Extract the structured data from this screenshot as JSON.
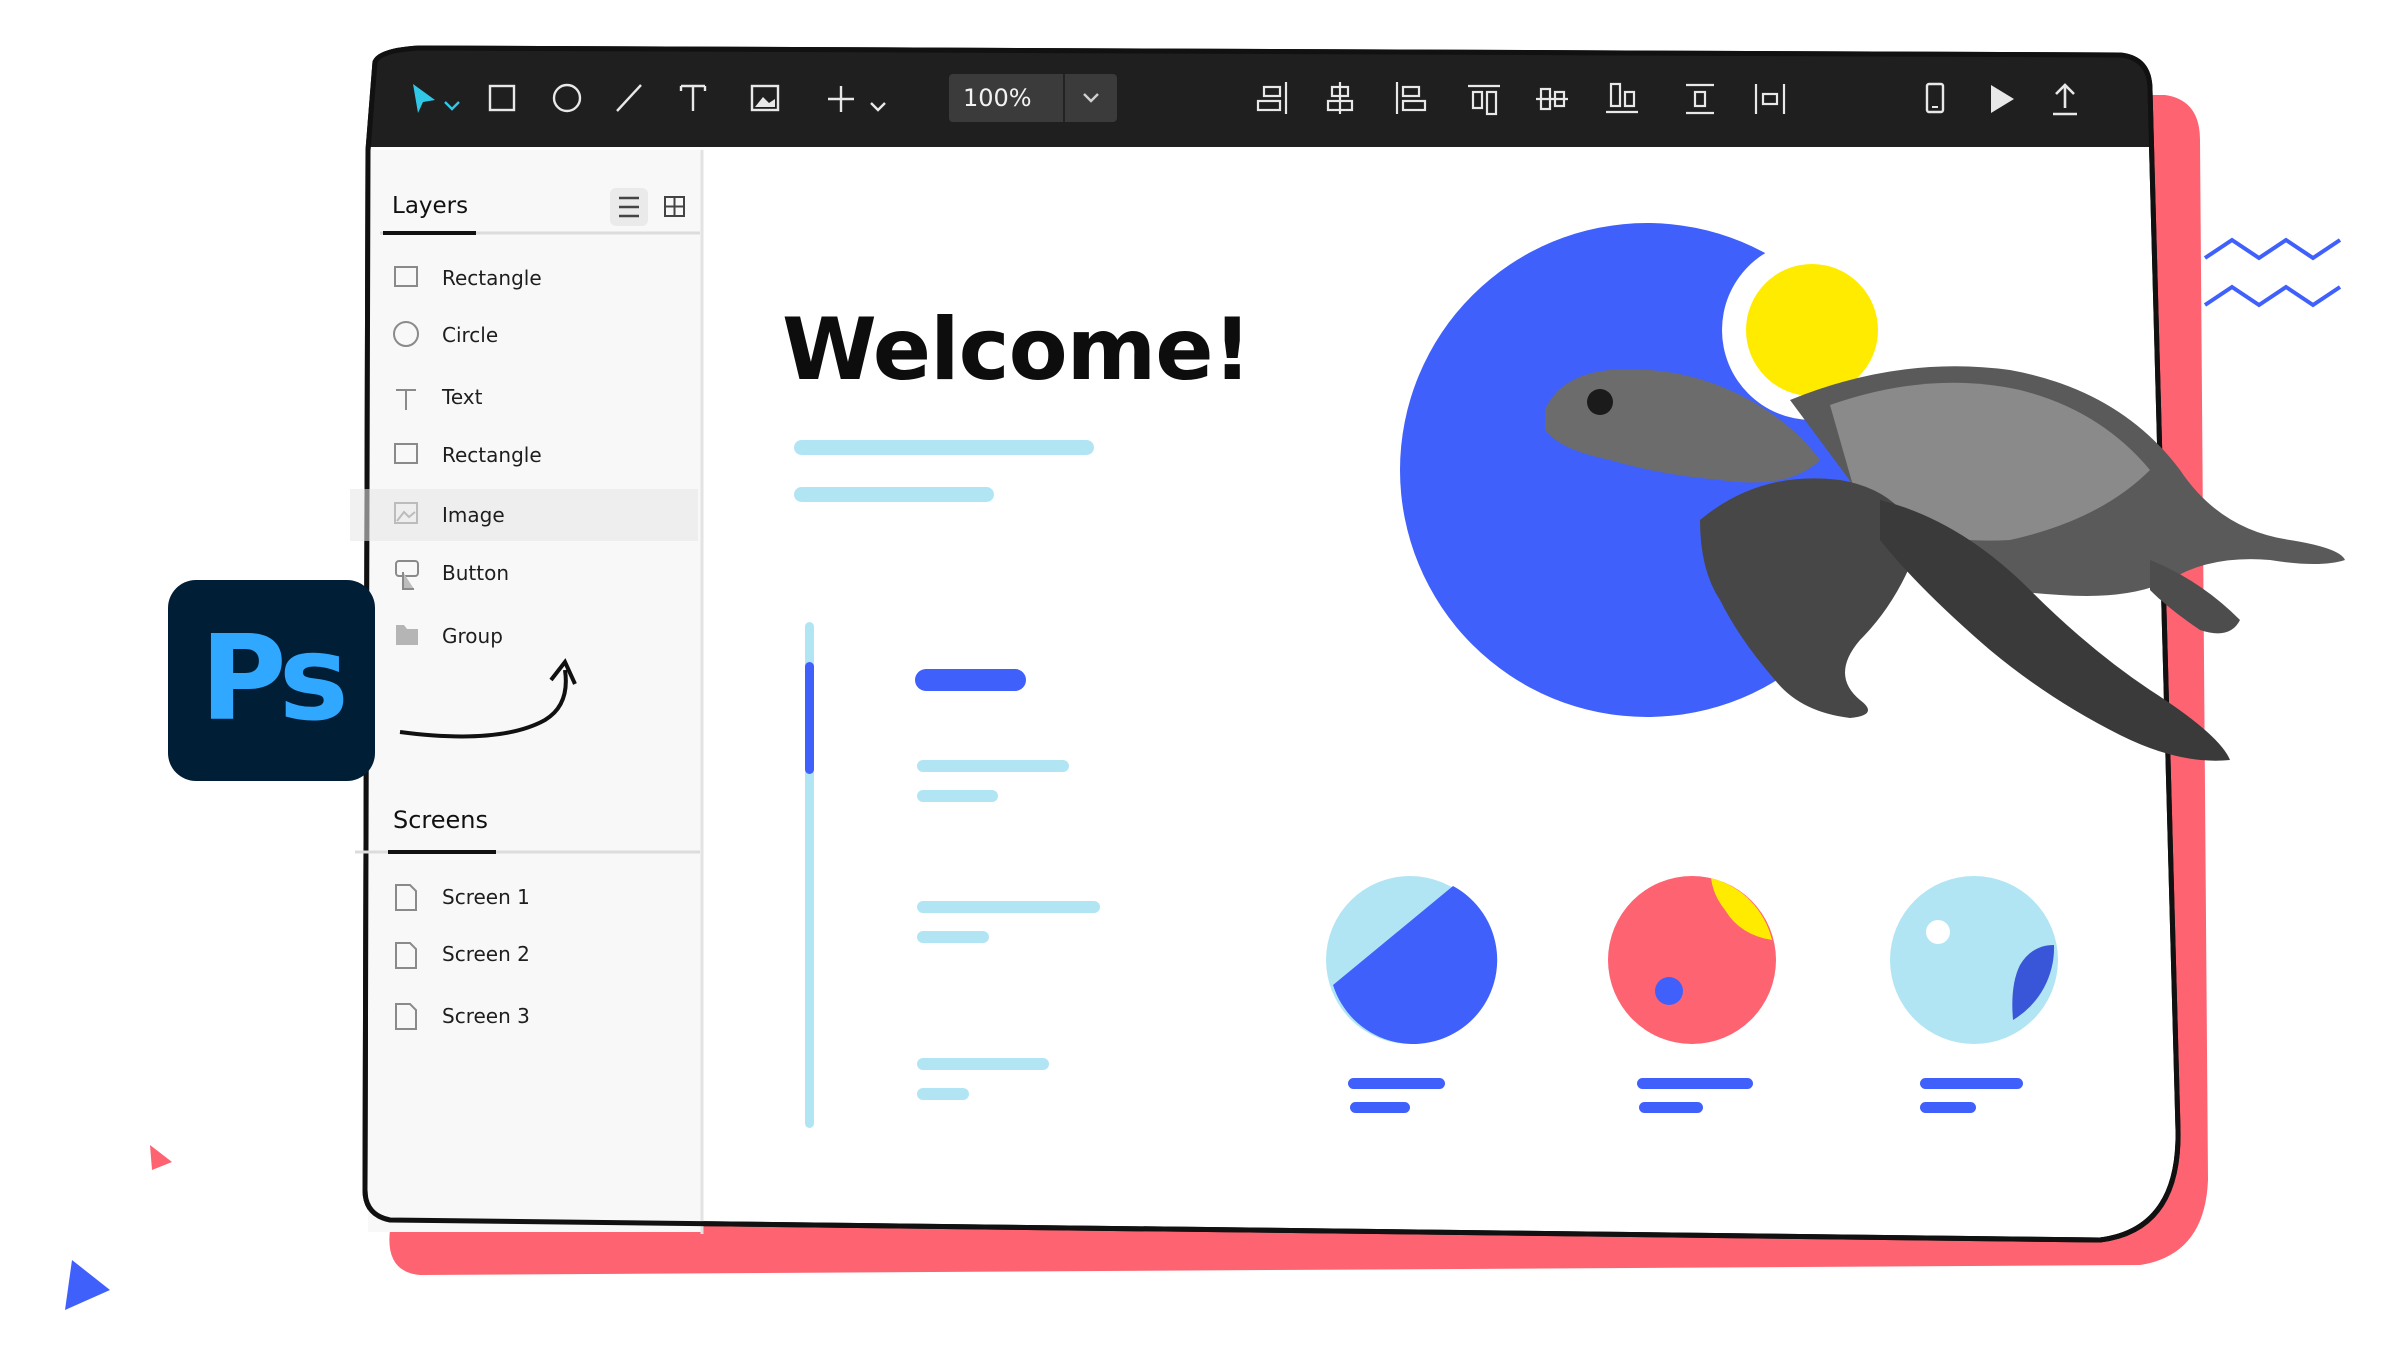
{
  "app": {
    "logo_text": "Ps",
    "accent": "#31a8ff",
    "frame_shadow": "#fe6371"
  },
  "toolbar": {
    "left_tools": [
      {
        "name": "select-tool-icon"
      },
      {
        "name": "rectangle-tool-icon"
      },
      {
        "name": "ellipse-tool-icon"
      },
      {
        "name": "line-tool-icon"
      },
      {
        "name": "text-tool-icon"
      },
      {
        "name": "image-tool-icon"
      },
      {
        "name": "add-icon"
      }
    ],
    "zoom_value": "100%",
    "align_tools": [
      {
        "name": "align-right-icon"
      },
      {
        "name": "align-center-horizontal-icon"
      },
      {
        "name": "align-left-icon"
      },
      {
        "name": "align-top-icon"
      },
      {
        "name": "align-middle-vertical-icon"
      },
      {
        "name": "align-bottom-icon"
      },
      {
        "name": "distribute-vertical-icon"
      },
      {
        "name": "distribute-horizontal-icon"
      }
    ],
    "right_tools": [
      {
        "name": "device-preview-icon"
      },
      {
        "name": "play-icon"
      },
      {
        "name": "export-icon"
      }
    ]
  },
  "layers_panel": {
    "title": "Layers",
    "items": [
      {
        "label": "Rectangle",
        "icon": "rectangle-icon"
      },
      {
        "label": "Circle",
        "icon": "circle-icon"
      },
      {
        "label": "Text",
        "icon": "text-icon"
      },
      {
        "label": "Rectangle",
        "icon": "rectangle-icon"
      },
      {
        "label": "Image",
        "icon": "image-icon",
        "selected": true
      },
      {
        "label": "Button",
        "icon": "button-icon"
      },
      {
        "label": "Group",
        "icon": "folder-icon"
      }
    ]
  },
  "screens_panel": {
    "title": "Screens",
    "items": [
      {
        "label": "Screen 1"
      },
      {
        "label": "Screen 2"
      },
      {
        "label": "Screen 3"
      }
    ]
  },
  "canvas": {
    "heading": "Welcome!",
    "colors": {
      "blue": "#4060fb",
      "light_blue": "#b2e5f4",
      "coral": "#fe6371",
      "yellow": "#ffeb00"
    }
  }
}
